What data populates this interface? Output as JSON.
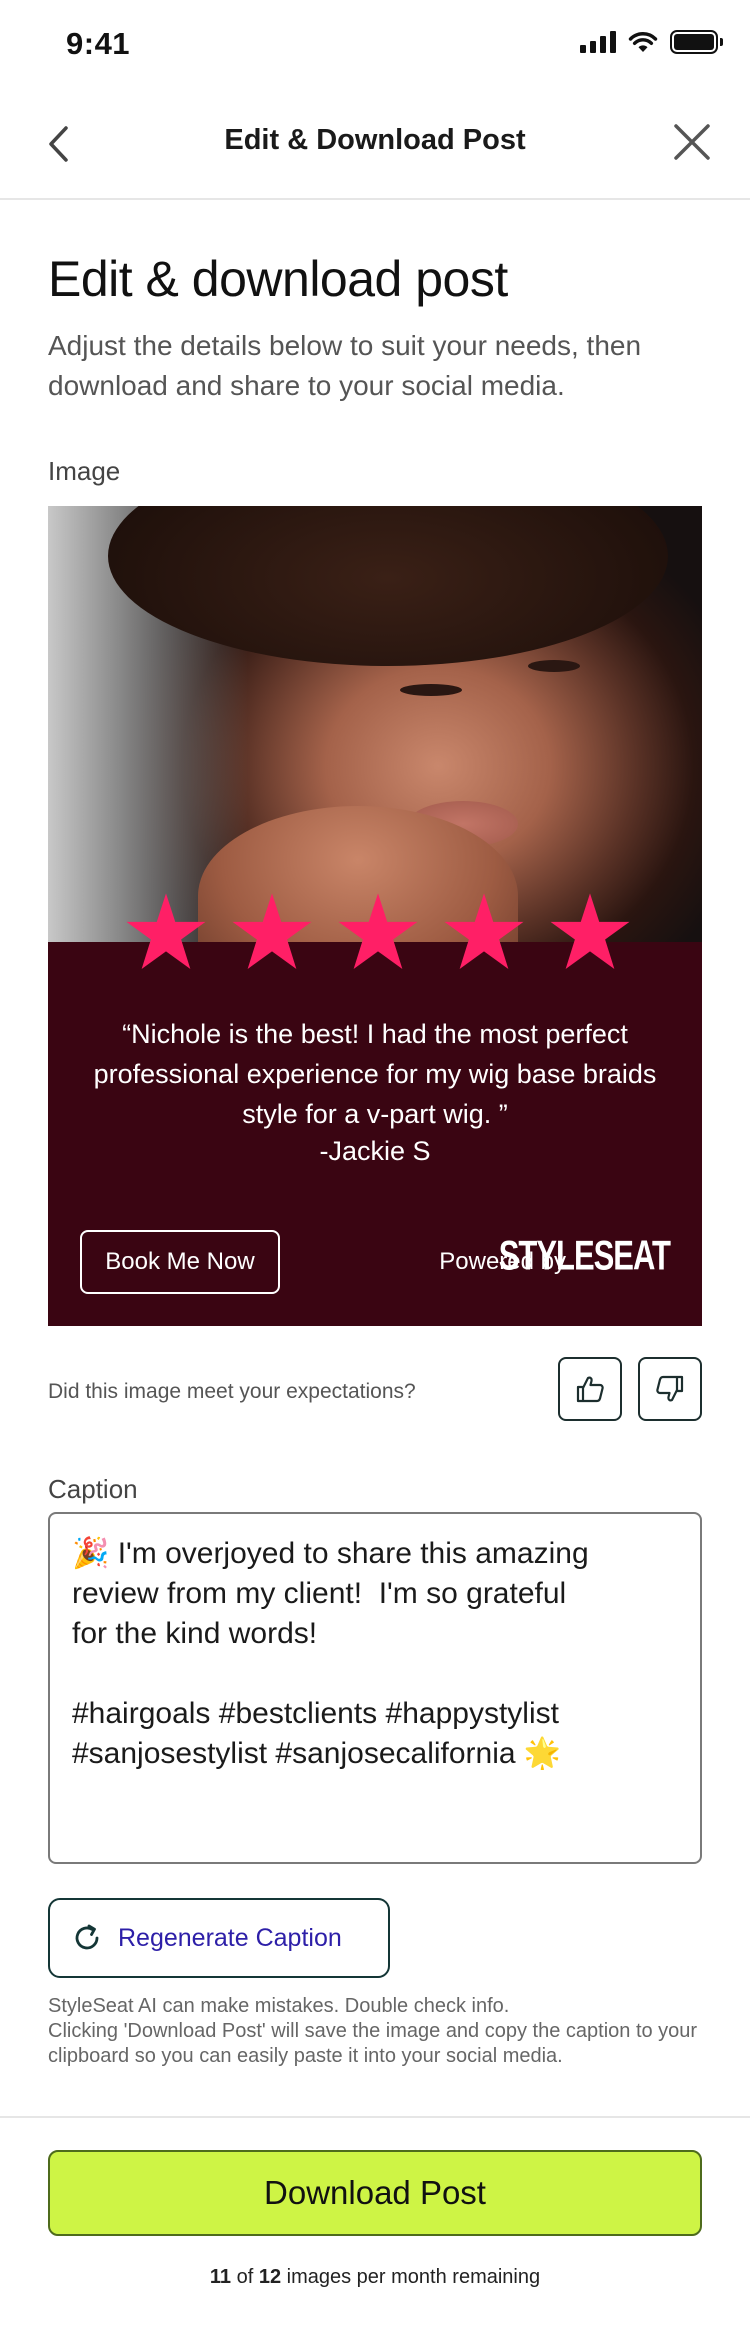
{
  "status_bar": {
    "time": "9:41"
  },
  "nav": {
    "title": "Edit & Download Post"
  },
  "header": {
    "title": "Edit & download post",
    "subtitle": "Adjust the details below to suit your needs, then download and share to your social media."
  },
  "image_section": {
    "label": "Image",
    "post": {
      "rating": 5,
      "star_color": "#ff1f66",
      "panel_color": "#3a0512",
      "quote": "“Nichole is the best! I had the most perfect professional experience for my wig base braids style for a v-part wig. ”",
      "reviewer": "-Jackie S",
      "book_button": "Book Me Now",
      "powered_by": "Powered by",
      "brand": "STYLESEAT"
    },
    "feedback_question": "Did this image meet your expectations?",
    "thumbs_up_icon": "thumbs-up-icon",
    "thumbs_down_icon": "thumbs-down-icon"
  },
  "caption_section": {
    "label": "Caption",
    "text": "🎉 I'm overjoyed to share this amazing\nreview from my client!  I'm so grateful\nfor the kind words!\n\n#hairgoals #bestclients #happystylist\n#sanjosestylist #sanjosecalifornia 🌟",
    "regenerate_label": "Regenerate Caption",
    "disclaimer": "StyleSeat AI can make mistakes. Double check info.\nClicking 'Download Post' will save the image and copy the caption to your clipboard so you can easily paste it into your social media."
  },
  "footer": {
    "download_label": "Download Post",
    "remaining_used": "11",
    "remaining_of": "of",
    "remaining_total": "12",
    "remaining_suffix": "images per month remaining",
    "accent_color": "#cef445"
  }
}
